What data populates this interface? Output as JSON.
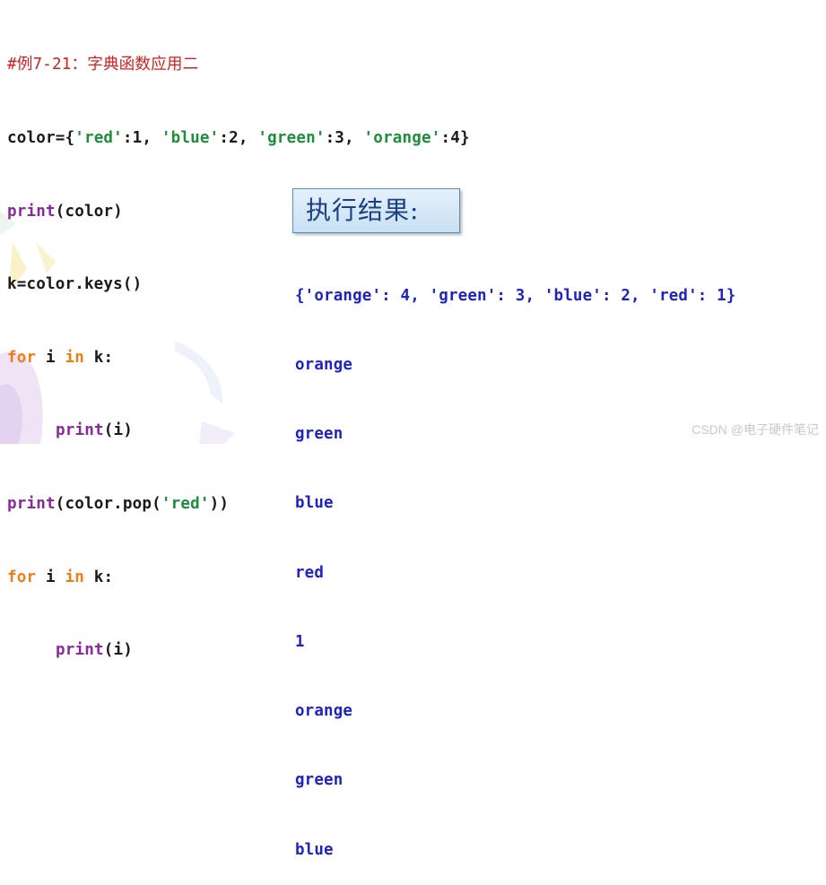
{
  "code": {
    "comment": "#例7-21：字典函数应用二",
    "line1": {
      "var": "color={",
      "k1": "'red'",
      "v1": ":1, ",
      "k2": "'blue'",
      "v2": ":2, ",
      "k3": "'green'",
      "v3": ":3, ",
      "k4": "'orange'",
      "v4": ":4}"
    },
    "line2": {
      "fn": "print",
      "rest": "(color)"
    },
    "line3": "k=color.keys()",
    "line4": {
      "kw1": "for",
      "mid": " i ",
      "kw2": "in",
      "rest": " k:"
    },
    "line5": {
      "fn": "print",
      "rest": "(i)"
    },
    "line6": {
      "fn": "print",
      "rest1": "(color.pop(",
      "str": "'red'",
      "rest2": "))"
    },
    "line7": {
      "kw1": "for",
      "mid": " i ",
      "kw2": "in",
      "rest": " k:"
    },
    "line8": {
      "fn": "print",
      "rest": "(i)"
    }
  },
  "result_label": "执行结果:",
  "output_lines": [
    "{'orange': 4, 'green': 3, 'blue': 2, 'red': 1}",
    "orange",
    "green",
    "blue",
    "red",
    "1",
    "orange",
    "green",
    "blue"
  ],
  "watermark": "CSDN @电子硬件笔记",
  "colors": {
    "comment": "#d21f1f",
    "keyword": "#ef7d16",
    "builtin": "#8a2a9a",
    "string": "#1b8f3a",
    "output": "#1f23c4",
    "result_label": "#1a3f82"
  }
}
